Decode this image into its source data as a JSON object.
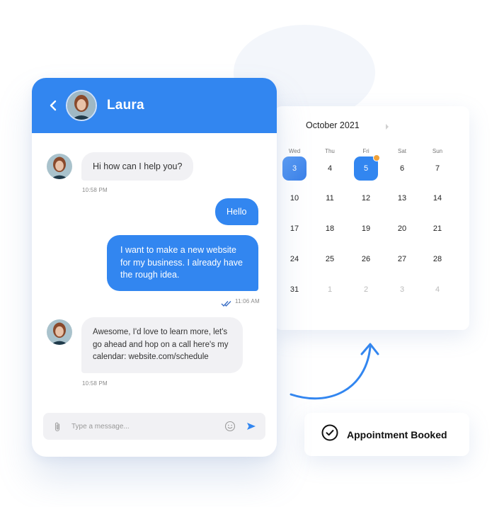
{
  "chat": {
    "contact_name": "Laura",
    "header_color": "#3286f0",
    "messages": [
      {
        "direction": "incoming",
        "text_lines": [
          "Hi how can I help you?"
        ],
        "time": "10:58 PM"
      },
      {
        "direction": "outgoing",
        "text_lines": [
          "Hello"
        ],
        "time": ""
      },
      {
        "direction": "outgoing",
        "text_lines": [
          "I want to make a new website",
          "for my business. I already have",
          "the rough idea."
        ],
        "time": "11:06 AM",
        "status": "read"
      },
      {
        "direction": "incoming",
        "text_lines": [
          "Awesome, I'd love to learn more, let's",
          "go ahead and hop on a call here's my",
          "calendar: website.com/schedule"
        ],
        "time": "10:58 PM"
      }
    ],
    "composer": {
      "placeholder": "Type a message..."
    }
  },
  "calendar": {
    "month_label": "October 2021",
    "weekdays": [
      "Wed",
      "Thu",
      "Fri",
      "Sat",
      "Sun"
    ],
    "rows": [
      [
        "3",
        "4",
        "5",
        "6",
        "7"
      ],
      [
        "10",
        "11",
        "12",
        "13",
        "14"
      ],
      [
        "17",
        "18",
        "19",
        "20",
        "21"
      ],
      [
        "24",
        "25",
        "26",
        "27",
        "28"
      ],
      [
        "31",
        "1",
        "2",
        "3",
        "4"
      ]
    ],
    "muted_next_month": [
      "1",
      "2",
      "3",
      "4"
    ],
    "selected_today": "3",
    "selected_event": "5",
    "event_dot_color": "#f0a23a"
  },
  "booking": {
    "label": "Appointment Booked"
  }
}
